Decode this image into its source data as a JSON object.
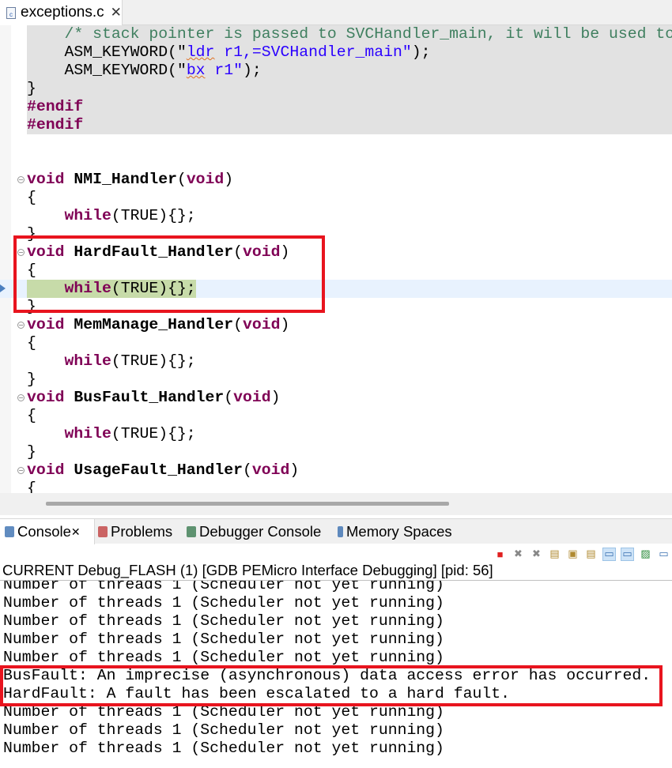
{
  "editor": {
    "tab_label": "exceptions.c",
    "tab_icon": "c-file-icon",
    "lines": [
      {
        "grey": true,
        "tokens": [
          [
            "    ",
            ""
          ],
          [
            "/* stack pointer is passed to SVCHandler_main, it will be used to",
            "cm"
          ]
        ]
      },
      {
        "grey": true,
        "tokens": [
          [
            "    ASM_KEYWORD(",
            ""
          ],
          [
            "\"",
            ""
          ],
          [
            "ldr",
            "str sq"
          ],
          [
            " r1,=SVCHandler_main\"",
            "str"
          ],
          [
            ");",
            ""
          ]
        ]
      },
      {
        "grey": true,
        "tokens": [
          [
            "    ASM_KEYWORD(",
            ""
          ],
          [
            "\"",
            ""
          ],
          [
            "bx",
            "str sq"
          ],
          [
            " r1\"",
            "str"
          ],
          [
            ");",
            ""
          ]
        ]
      },
      {
        "grey": true,
        "tokens": [
          [
            "}",
            ""
          ]
        ]
      },
      {
        "grey": true,
        "tokens": [
          [
            "#endif",
            "pp"
          ]
        ]
      },
      {
        "grey": true,
        "tokens": [
          [
            "#endif",
            "pp"
          ]
        ]
      },
      {
        "tokens": []
      },
      {
        "tokens": []
      },
      {
        "fold": true,
        "tokens": [
          [
            "void",
            "kw"
          ],
          [
            " ",
            ""
          ],
          [
            "NMI_Handler",
            "fn"
          ],
          [
            "(",
            ""
          ],
          [
            "void",
            "kw"
          ],
          [
            ")",
            ""
          ]
        ]
      },
      {
        "tokens": [
          [
            "{",
            ""
          ]
        ]
      },
      {
        "tokens": [
          [
            "    ",
            ""
          ],
          [
            "while",
            "kw"
          ],
          [
            "(TRUE){};",
            ""
          ]
        ]
      },
      {
        "tokens": [
          [
            "}",
            ""
          ]
        ]
      },
      {
        "fold": true,
        "tokens": [
          [
            "void",
            "kw"
          ],
          [
            " ",
            ""
          ],
          [
            "HardFault_Handler",
            "fn"
          ],
          [
            "(",
            ""
          ],
          [
            "void",
            "kw"
          ],
          [
            ")",
            ""
          ]
        ]
      },
      {
        "tokens": [
          [
            "{",
            ""
          ]
        ]
      },
      {
        "current": true,
        "tokens": [
          [
            "    ",
            ""
          ],
          [
            "while",
            "kw"
          ],
          [
            "(TRUE){};",
            ""
          ]
        ]
      },
      {
        "tokens": [
          [
            "}",
            ""
          ]
        ]
      },
      {
        "fold": true,
        "tokens": [
          [
            "void",
            "kw"
          ],
          [
            " ",
            ""
          ],
          [
            "MemManage_Handler",
            "fn"
          ],
          [
            "(",
            ""
          ],
          [
            "void",
            "kw"
          ],
          [
            ")",
            ""
          ]
        ]
      },
      {
        "tokens": [
          [
            "{",
            ""
          ]
        ]
      },
      {
        "tokens": [
          [
            "    ",
            ""
          ],
          [
            "while",
            "kw"
          ],
          [
            "(TRUE){};",
            ""
          ]
        ]
      },
      {
        "tokens": [
          [
            "}",
            ""
          ]
        ]
      },
      {
        "fold": true,
        "tokens": [
          [
            "void",
            "kw"
          ],
          [
            " ",
            ""
          ],
          [
            "BusFault_Handler",
            "fn"
          ],
          [
            "(",
            ""
          ],
          [
            "void",
            "kw"
          ],
          [
            ")",
            ""
          ]
        ]
      },
      {
        "tokens": [
          [
            "{",
            ""
          ]
        ]
      },
      {
        "tokens": [
          [
            "    ",
            ""
          ],
          [
            "while",
            "kw"
          ],
          [
            "(TRUE){};",
            ""
          ]
        ]
      },
      {
        "tokens": [
          [
            "}",
            ""
          ]
        ]
      },
      {
        "fold": true,
        "tokens": [
          [
            "void",
            "kw"
          ],
          [
            " ",
            ""
          ],
          [
            "UsageFault_Handler",
            "fn"
          ],
          [
            "(",
            ""
          ],
          [
            "void",
            "kw"
          ],
          [
            ")",
            ""
          ]
        ]
      },
      {
        "tokens": [
          [
            "{",
            ""
          ]
        ]
      }
    ]
  },
  "console": {
    "tabs": [
      {
        "label": "Console",
        "icon": "console-icon",
        "active": true
      },
      {
        "label": "Problems",
        "icon": "problems-icon"
      },
      {
        "label": "Debugger Console",
        "icon": "debugger-console-icon"
      },
      {
        "label": "Memory Spaces",
        "icon": "memory-spaces-icon"
      }
    ],
    "toolbar": [
      "terminate-icon",
      "remove-launch-icon",
      "remove-all-launches-icon",
      "clear-console-icon",
      "scroll-lock-icon",
      "word-wrap-icon",
      "show-on-stdout-icon",
      "show-on-stderr-icon",
      "pin-console-icon",
      "open-console-icon"
    ],
    "header": "CURRENT Debug_FLASH (1) [GDB PEMicro Interface Debugging]  [pid: 56]",
    "lines": [
      "Number of threads 1 (Scheduler not yet running)",
      "Number of threads 1 (Scheduler not yet running)",
      "Number of threads 1 (Scheduler not yet running)",
      "Number of threads 1 (Scheduler not yet running)",
      "Number of threads 1 (Scheduler not yet running)",
      "BusFault: An imprecise (asynchronous) data access error has occurred.",
      "HardFault: A fault has been escalated to a hard fault.",
      "Number of threads 1 (Scheduler not yet running)",
      "Number of threads 1 (Scheduler not yet running)",
      "Number of threads 1 (Scheduler not yet running)"
    ]
  },
  "colors": {
    "highlight_box": "#e8141e",
    "current_line": "#c7dba9",
    "keyword": "#7f0055",
    "string": "#2a00ff",
    "comment": "#3f7f5f"
  }
}
